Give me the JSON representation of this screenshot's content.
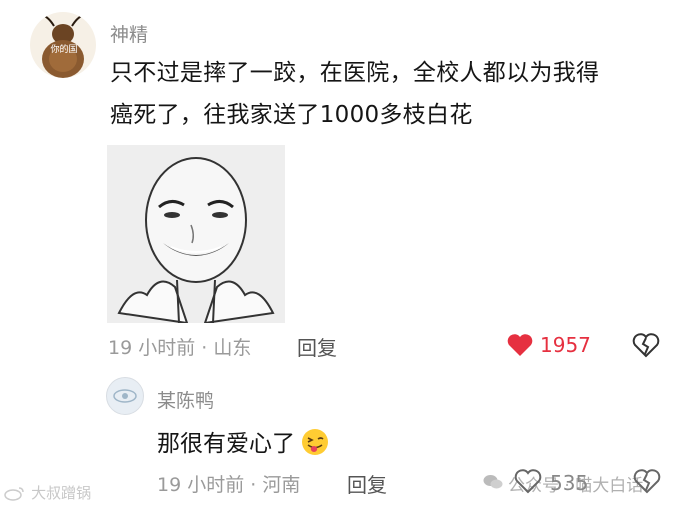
{
  "comment": {
    "username": "神精",
    "text_line1": "只不过是摔了一跤，在医院，全校人都以为我得",
    "text_line2": "癌死了，往我家送了1000多枝白花",
    "time_location": "19 小时前 · 山东",
    "reply_label": "回复",
    "like_count": "1957",
    "like_color": "#e63040",
    "avatar_text": "你的国"
  },
  "reply": {
    "username": "某陈鸭",
    "text": "那很有爱心了",
    "time_location": "19 小时前 · 河南",
    "reply_label": "回复",
    "like_count": "535"
  },
  "watermarks": {
    "left": "大叔蹭锅",
    "right": "公众号 · 喵大白话"
  },
  "icons": [
    "heart-filled-icon",
    "broken-heart-icon",
    "heart-outline-icon",
    "wechat-icon",
    "weibo-icon",
    "tongue-wink-emoji"
  ]
}
